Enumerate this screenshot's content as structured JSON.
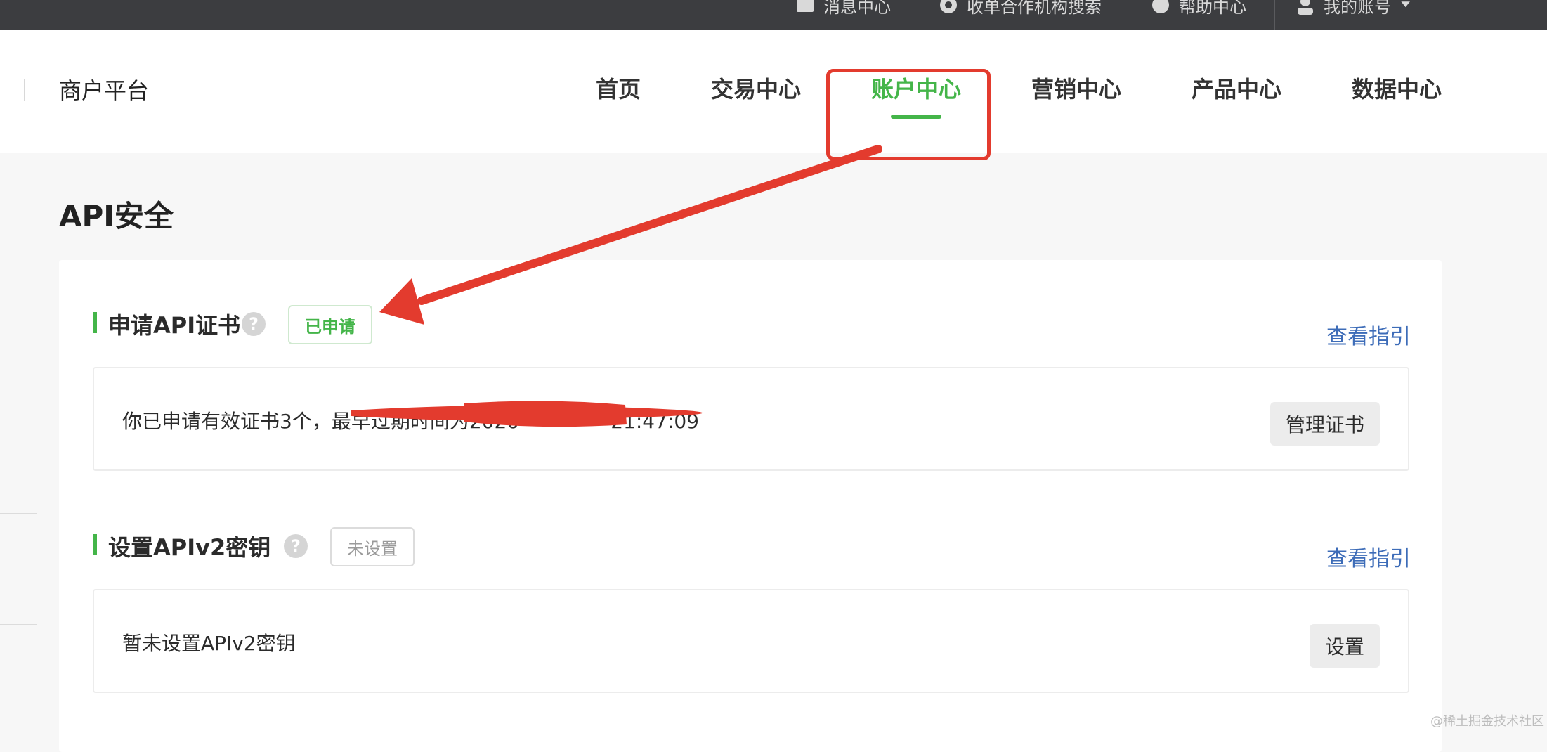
{
  "utility_bar": {
    "items": [
      {
        "label": "消息中心",
        "icon": "message-icon"
      },
      {
        "label": "收单合作机构搜索",
        "icon": "search-agency-icon"
      },
      {
        "label": "帮助中心",
        "icon": "help-circle-icon"
      },
      {
        "label": "我的账号",
        "icon": "user-icon"
      }
    ]
  },
  "header": {
    "brand": "商户平台",
    "nav": [
      {
        "label": "首页"
      },
      {
        "label": "交易中心"
      },
      {
        "label": "账户中心",
        "active": true
      },
      {
        "label": "营销中心"
      },
      {
        "label": "产品中心"
      },
      {
        "label": "数据中心"
      }
    ]
  },
  "page": {
    "title": "API安全"
  },
  "sections": [
    {
      "title": "申请API证书",
      "status": "已申请",
      "guide_link": "查看指引",
      "row_text": "你已申请有效证书3个，最早过期时间为2020-",
      "row_text_tail": "21:47:09",
      "button": "管理证书"
    },
    {
      "title": "设置APIv2密钥",
      "status": "未设置",
      "guide_link": "查看指引",
      "row_text": "暂未设置APIv2密钥",
      "button": "设置"
    }
  ],
  "watermark": "@稀土掘金技术社区",
  "colors": {
    "accent_green": "#44b549",
    "link_blue": "#3d6cb8",
    "annotation_red": "#e33b2e",
    "topbar_bg": "#3c3d40"
  }
}
